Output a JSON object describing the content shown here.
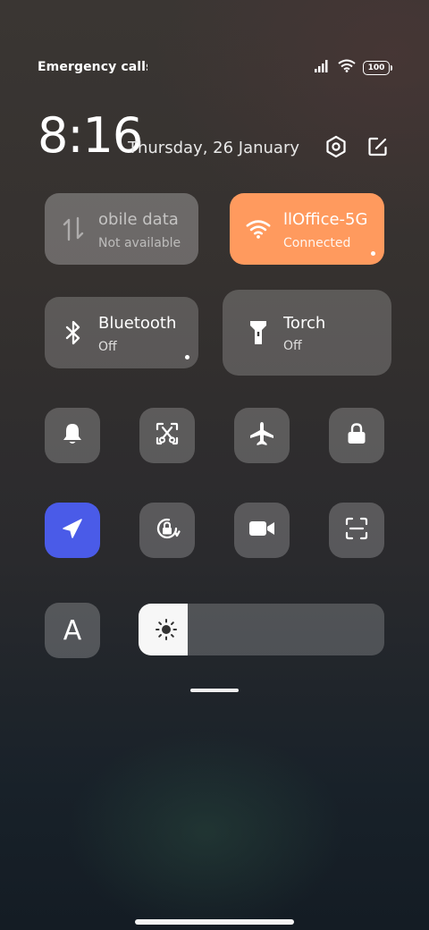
{
  "status_bar": {
    "left_text": "Emergency calls o",
    "battery": "100",
    "icons": [
      "signal-icon",
      "wifi-icon",
      "battery-icon"
    ]
  },
  "header": {
    "time": "8:16",
    "date": "Thursday, 26 January",
    "icons": [
      "settings-icon",
      "edit-icon"
    ]
  },
  "tiles": {
    "mobile_data": {
      "name": "obile data",
      "status": "Not available"
    },
    "wifi": {
      "name": "llOffice-5G",
      "status": "Connected",
      "accent": "#FF9A5E"
    },
    "bluetooth": {
      "name": "Bluetooth",
      "status": "Off"
    },
    "torch": {
      "name": "Torch",
      "status": "Off"
    }
  },
  "toggles": [
    {
      "icon": "bell-icon",
      "active": false
    },
    {
      "icon": "screenshot-icon",
      "active": false
    },
    {
      "icon": "airplane-icon",
      "active": false
    },
    {
      "icon": "lock-icon",
      "active": false
    },
    {
      "icon": "location-icon",
      "active": true,
      "accent": "#4A5BE8"
    },
    {
      "icon": "rotation-lock-icon",
      "active": false
    },
    {
      "icon": "video-camera-icon",
      "active": false
    },
    {
      "icon": "scan-icon",
      "active": false
    }
  ],
  "font_size_label": "A",
  "brightness": {
    "level_percent": 20
  }
}
